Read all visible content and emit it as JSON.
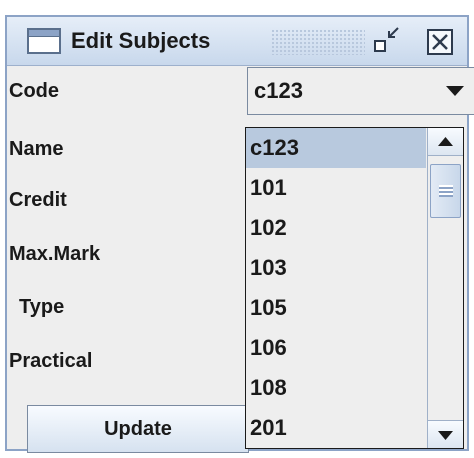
{
  "window": {
    "title": "Edit Subjects",
    "icons": {
      "app": "window-icon",
      "minimize": "minimize-icon",
      "close": "close-icon"
    }
  },
  "form": {
    "labels": {
      "code": "Code",
      "name": "Name",
      "credit": "Credit",
      "max_mark": "Max.Mark",
      "type": "Type",
      "practical": "Practical"
    },
    "code_combo": {
      "selected": "c123"
    },
    "update_label": "Update"
  },
  "dropdown": {
    "options": [
      "c123",
      "101",
      "102",
      "103",
      "105",
      "106",
      "108",
      "201"
    ],
    "selected_option": "c123"
  },
  "colors": {
    "window_bg": "#eeeeee",
    "titlebar": "#c8d8ec",
    "selection": "#b8c9de",
    "border": "#8ca3c6"
  }
}
